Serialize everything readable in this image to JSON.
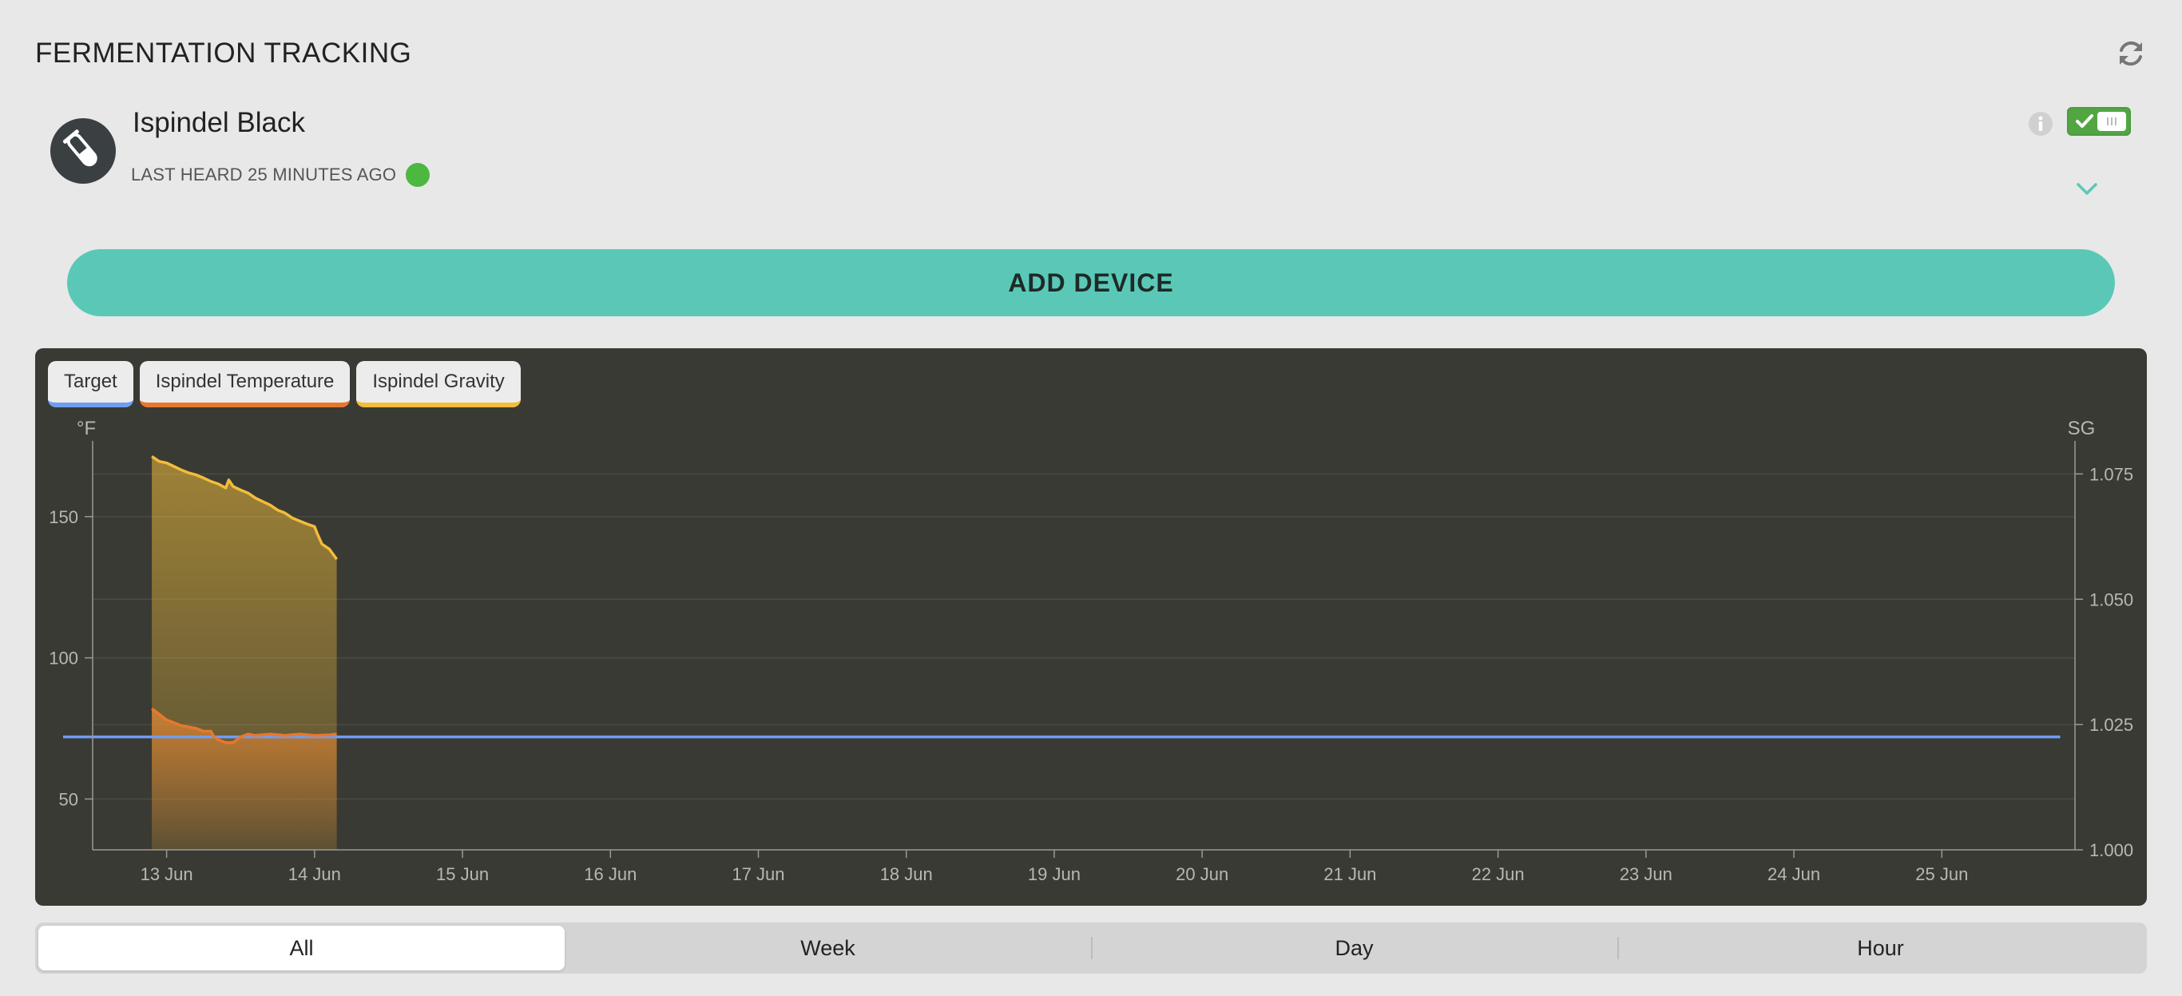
{
  "header": {
    "title": "FERMENTATION TRACKING",
    "refresh_icon": "refresh-icon"
  },
  "device": {
    "name": "Ispindel Black",
    "status": "LAST HEARD 25 MINUTES AGO",
    "status_color": "#4cb840",
    "avatar_icon": "test-tube-icon",
    "enabled": true
  },
  "add_device_label": "ADD DEVICE",
  "colors": {
    "accent": "#5bc8b7",
    "chart_bg": "#393a33",
    "target": "#6f9df2",
    "temperature": "#e8772e",
    "gravity": "#f2bd3a"
  },
  "chart_data": {
    "type": "line",
    "legend": [
      {
        "name": "Target",
        "color": "#6f9df2"
      },
      {
        "name": "Ispindel Temperature",
        "color": "#e8772e"
      },
      {
        "name": "Ispindel Gravity",
        "color": "#f2bd3a"
      }
    ],
    "x_ticks": [
      "13 Jun",
      "14 Jun",
      "15 Jun",
      "16 Jun",
      "17 Jun",
      "18 Jun",
      "19 Jun",
      "20 Jun",
      "21 Jun",
      "22 Jun",
      "23 Jun",
      "24 Jun",
      "25 Jun"
    ],
    "xlim": [
      12.5,
      25.9
    ],
    "y_left": {
      "unit": "°F",
      "ticks": [
        50,
        100,
        150
      ],
      "range": [
        32,
        174
      ]
    },
    "y_right": {
      "unit": "SG",
      "ticks": [
        "1.000",
        "1.025",
        "1.050",
        "1.075"
      ],
      "range": [
        1.0,
        1.08
      ]
    },
    "grid": true,
    "series": [
      {
        "name": "Target",
        "axis": "left",
        "area": false,
        "x": [
          12.3,
          25.8
        ],
        "y": [
          72,
          72
        ]
      },
      {
        "name": "Ispindel Temperature",
        "axis": "left",
        "area": true,
        "x": [
          12.9,
          12.95,
          13.0,
          13.05,
          13.1,
          13.15,
          13.2,
          13.25,
          13.3,
          13.32,
          13.35,
          13.4,
          13.45,
          13.5,
          13.55,
          13.6,
          13.7,
          13.8,
          13.9,
          14.0,
          14.1,
          14.15
        ],
        "y": [
          82,
          80,
          78,
          77,
          76,
          75.5,
          75,
          74,
          74,
          72,
          71,
          70,
          70,
          72,
          73,
          72.5,
          73,
          72.5,
          73,
          72.5,
          72.7,
          73
        ]
      },
      {
        "name": "Ispindel Gravity",
        "axis": "right",
        "area": true,
        "x": [
          12.9,
          12.95,
          13.0,
          13.05,
          13.1,
          13.15,
          13.2,
          13.25,
          13.3,
          13.35,
          13.4,
          13.42,
          13.45,
          13.5,
          13.55,
          13.6,
          13.65,
          13.7,
          13.75,
          13.8,
          13.85,
          13.9,
          13.95,
          14.0,
          14.02,
          14.05,
          14.1,
          14.15
        ],
        "y": [
          1.0785,
          1.0775,
          1.0772,
          1.0765,
          1.0758,
          1.0752,
          1.0748,
          1.0742,
          1.0735,
          1.073,
          1.0722,
          1.0738,
          1.0725,
          1.0718,
          1.0712,
          1.0702,
          1.0695,
          1.0688,
          1.0678,
          1.0672,
          1.0662,
          1.0656,
          1.065,
          1.0645,
          1.063,
          1.061,
          1.06,
          1.058
        ]
      }
    ]
  },
  "range_tabs": [
    {
      "label": "All",
      "active": true
    },
    {
      "label": "Week",
      "active": false
    },
    {
      "label": "Day",
      "active": false
    },
    {
      "label": "Hour",
      "active": false
    }
  ]
}
